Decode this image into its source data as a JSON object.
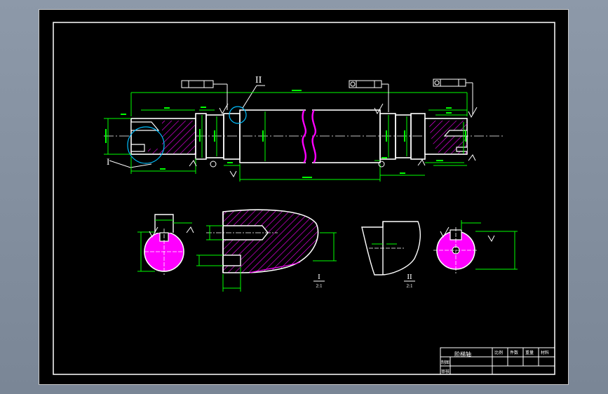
{
  "drawing": {
    "background": "#000000",
    "frame_color": "#ffffff",
    "dimension_color": "#00ff00",
    "hatch_color": "#ff00ff",
    "center_line_color": "#ffffff",
    "detail_circle_color": "#00bfff",
    "annotation_color": "#ffffff"
  },
  "labels": {
    "view_marker_1": "I",
    "view_marker_2": "II",
    "detail_label_1": "I",
    "detail_scale_1": "2:1",
    "detail_label_2": "II",
    "detail_scale_2": "2:1"
  },
  "title_block": {
    "part_name": "阶梯轴",
    "header_cells": [
      "比例",
      "件数",
      "重量",
      "材料"
    ],
    "row_labels": [
      "制图",
      "审核"
    ]
  }
}
